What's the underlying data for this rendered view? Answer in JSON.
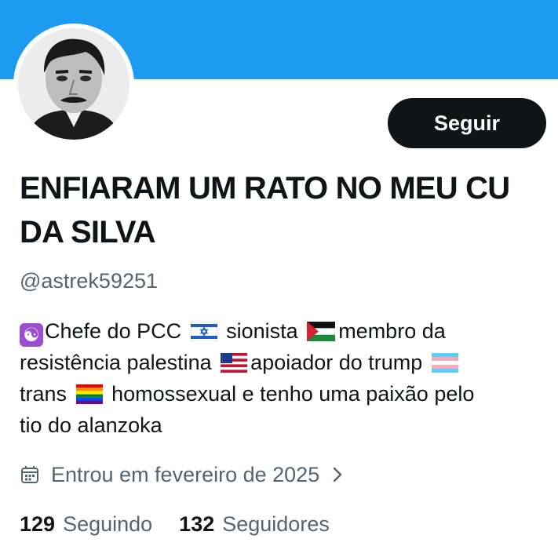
{
  "profile": {
    "display_name": "ENFIARAM UM RATO NO MEU CU DA SILVA",
    "handle": "@astrek59251",
    "follow_label": "Seguir",
    "bio": {
      "line1_a": "Chefe do PCC",
      "line1_b": "sionista",
      "line1_c": "membro da",
      "line2_a": "resistência palestina",
      "line2_b": "apoiador do trump",
      "line3_a": "trans",
      "line3_b": "homossexual e tenho uma paixão pelo",
      "line4": "tio do alanzoka"
    },
    "joined": "Entrou em fevereiro de 2025",
    "following_count": "129",
    "following_label": "Seguindo",
    "followers_count": "132",
    "followers_label": "Seguidores"
  },
  "icons": {
    "bio_emojis": [
      "yin-yang",
      "israel-flag",
      "palestine-flag",
      "usa-flag",
      "transgender-flag",
      "rainbow-flag"
    ],
    "joined": "calendar-icon",
    "chevron": "chevron-right-icon"
  },
  "colors": {
    "banner": "#1d9bf0",
    "follow_button": "#0f1419",
    "secondary_text": "#536471"
  }
}
